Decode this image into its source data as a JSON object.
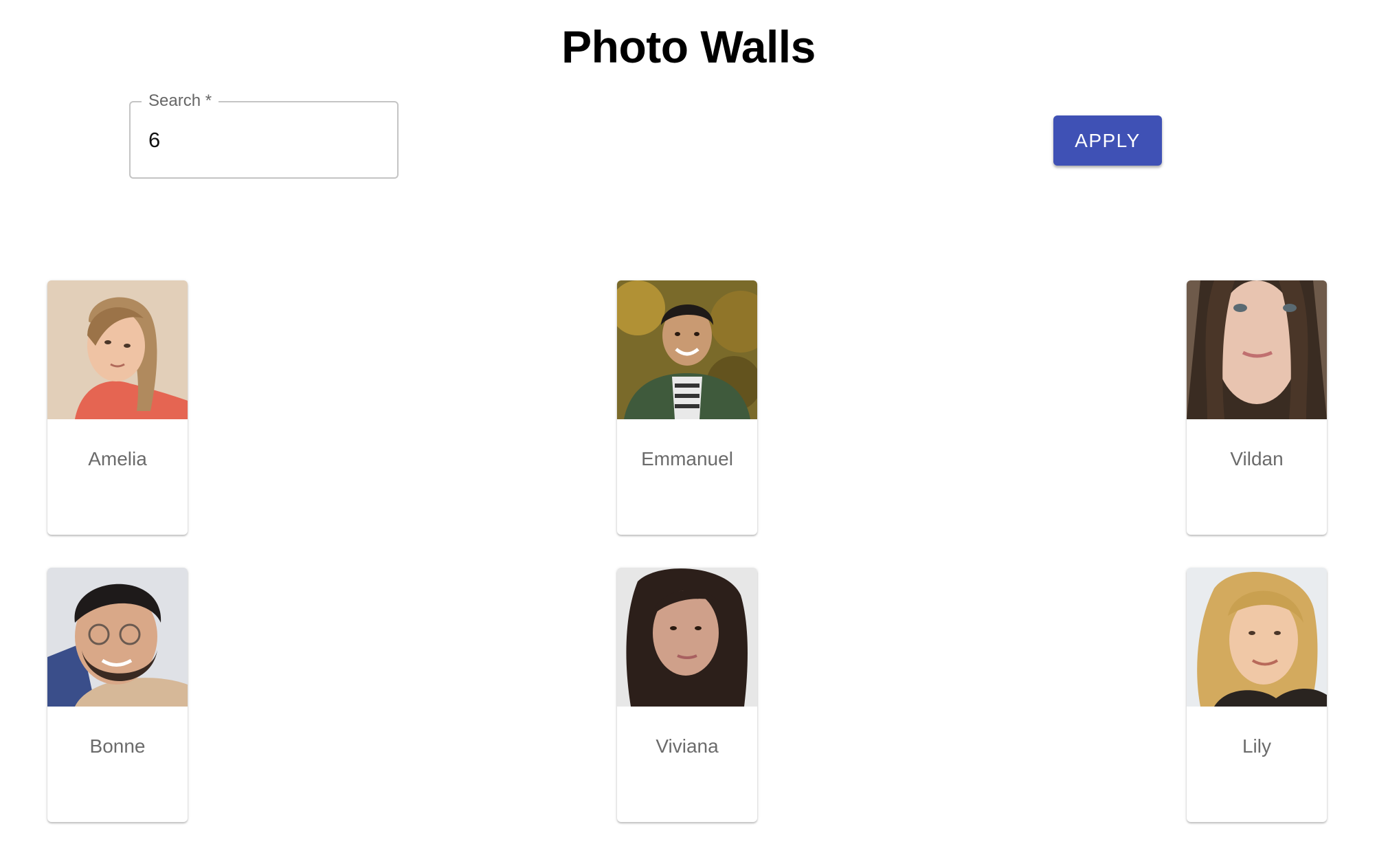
{
  "page": {
    "title": "Photo Walls"
  },
  "search": {
    "label": "Search",
    "required_mark": "*",
    "value": "6"
  },
  "apply_button": {
    "label": "APPLY",
    "color": "#3f51b5"
  },
  "people": [
    {
      "name": "Amelia"
    },
    {
      "name": "Emmanuel"
    },
    {
      "name": "Vildan"
    },
    {
      "name": "Bonne"
    },
    {
      "name": "Viviana"
    },
    {
      "name": "Lily"
    }
  ]
}
